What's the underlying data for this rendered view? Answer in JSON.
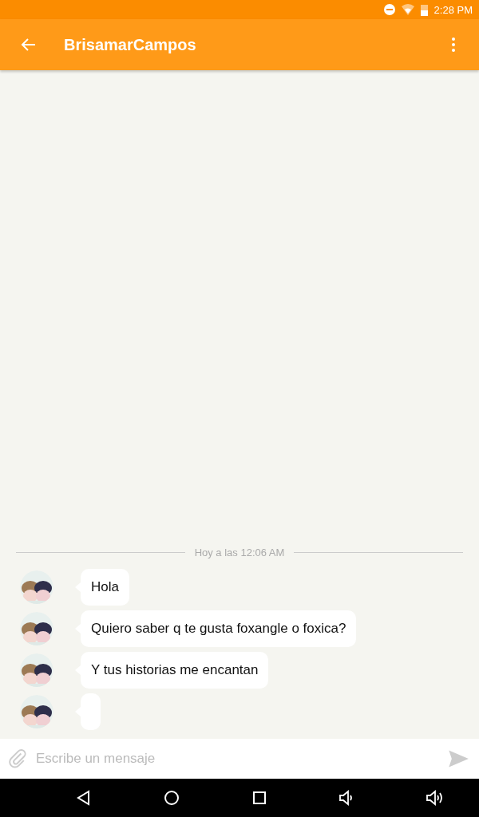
{
  "status_bar": {
    "time": "2:28 PM"
  },
  "app_bar": {
    "title": "BrisamarCampos"
  },
  "chat": {
    "date_divider": "Hoy a las 12:06 AM",
    "messages": [
      {
        "kind": "text",
        "text": "Hola"
      },
      {
        "kind": "text",
        "text": "Quiero saber q te gusta foxangle o foxica?"
      },
      {
        "kind": "text",
        "text": "Y tus historias me encantan"
      },
      {
        "kind": "blank"
      }
    ]
  },
  "composer": {
    "placeholder": "Escribe un mensaje"
  }
}
